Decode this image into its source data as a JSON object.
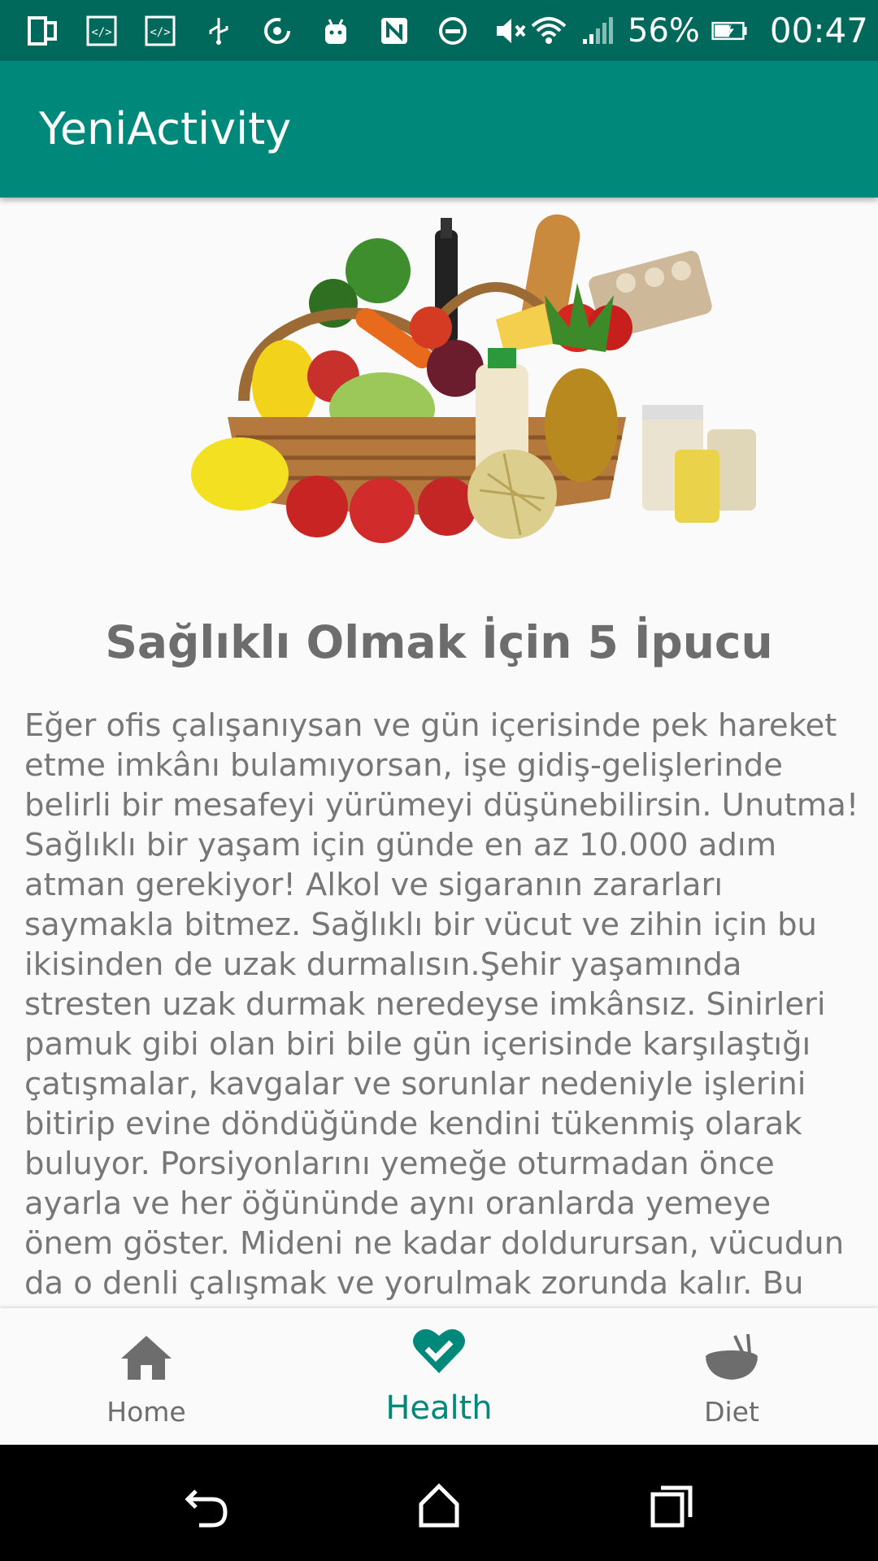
{
  "status_bar": {
    "battery_percent": "56%",
    "time": "00:47",
    "icons": [
      "sim-card-icon",
      "code-icon",
      "code-icon",
      "usb-icon",
      "sync-icon",
      "android-icon",
      "nfc-icon",
      "dnd-icon",
      "mute-icon",
      "wifi-icon",
      "signal-icon",
      "battery-charging-icon"
    ]
  },
  "app_bar": {
    "title": "YeniActivity"
  },
  "content": {
    "image_alt": "grocery-basket-image",
    "heading": "Sağlıklı Olmak İçin 5 İpucu",
    "body": "Eğer ofis çalışanıysan ve gün içerisinde pek hareket etme imkânı bulamıyorsan, işe gidiş-gelişlerinde belirli bir mesafeyi yürümeyi düşünebilirsin. Unutma! Sağlıklı bir yaşam için günde en az 10.000 adım atman gerekiyor! Alkol ve sigaranın zararları saymakla bitmez. Sağlıklı bir vücut ve zihin için bu ikisinden de uzak durmalısın.Şehir yaşamında stresten uzak durmak neredeyse imkânsız. Sinirleri pamuk gibi olan biri bile gün içerisinde karşılaştığı çatışmalar, kavgalar ve sorunlar nedeniyle işlerini bitirip evine döndüğünde kendini tükenmiş olarak buluyor. Porsiyonlarını yemeğe oturmadan önce ayarla ve her öğününde aynı oranlarda yemeye önem göster. Mideni ne kadar doldurursan, vücudun da o denli çalışmak ve yorulmak zorunda kalır. Bu sebepten sağlıklı beslenmenin yanında belirli"
  },
  "bottom_nav": {
    "items": [
      {
        "label": "Home",
        "icon": "home-icon",
        "active": false
      },
      {
        "label": "Health",
        "icon": "heart-check-icon",
        "active": true
      },
      {
        "label": "Diet",
        "icon": "bowl-icon",
        "active": false
      }
    ],
    "active_color": "#00897b",
    "inactive_color": "#6d6d6d"
  },
  "system_nav": {
    "buttons": [
      "back-icon",
      "home-outline-icon",
      "recents-icon"
    ]
  },
  "colors": {
    "primary": "#00897b",
    "primary_dark": "#00695c"
  }
}
